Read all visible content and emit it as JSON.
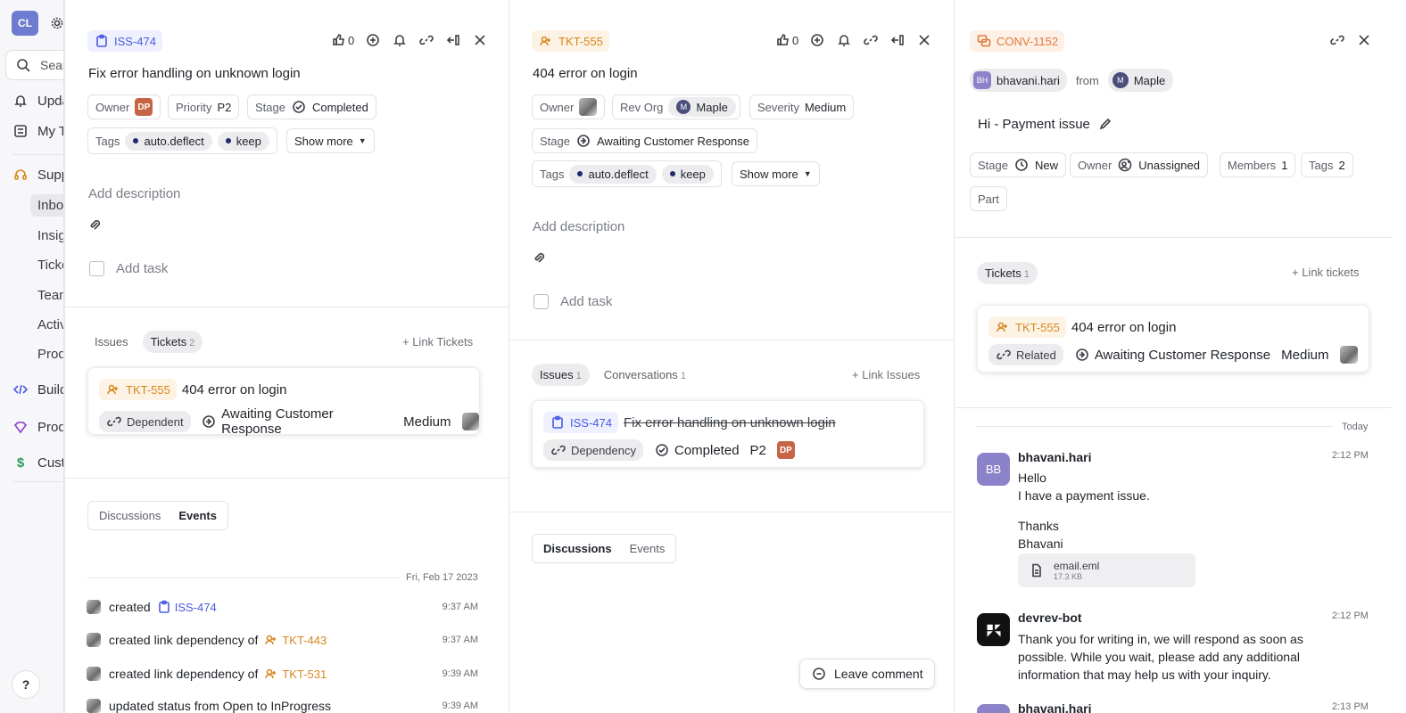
{
  "sidebar": {
    "avatar": "CL",
    "search_placeholder": "Search",
    "items": [
      {
        "label": "Updates",
        "icon": "bell-icon"
      },
      {
        "label": "My Tasks",
        "icon": "list-icon"
      }
    ],
    "support": {
      "label": "Support",
      "icon": "headset-icon"
    },
    "support_sub": [
      "Inbox",
      "Insights",
      "Tickets",
      "Team",
      "Activity",
      "Product"
    ],
    "more": [
      {
        "label": "Build",
        "icon": "code-icon"
      },
      {
        "label": "Product",
        "icon": "diamond-icon"
      },
      {
        "label": "Customers",
        "icon": "dollar-icon"
      }
    ],
    "help": "?"
  },
  "issue": {
    "id": "ISS-474",
    "upvotes": "0",
    "title": "Fix error handling on unknown login",
    "owner_label": "Owner",
    "owner_initials": "DP",
    "priority_label": "Priority",
    "priority_value": "P2",
    "stage_label": "Stage",
    "stage_value": "Completed",
    "tags_label": "Tags",
    "tags": [
      "auto.deflect",
      "keep"
    ],
    "show_more": "Show more",
    "add_description": "Add description",
    "add_task": "Add task",
    "tabs": {
      "issues": "Issues",
      "tickets": "Tickets",
      "tickets_count": "2"
    },
    "link_tickets": "+ Link Tickets",
    "linked_ticket": {
      "id": "TKT-555",
      "title": "404 error on login",
      "relation": "Dependent",
      "status": "Awaiting Customer Response",
      "severity": "Medium"
    },
    "seg": {
      "discussions": "Discussions",
      "events": "Events"
    },
    "date_sep": "Fri, Feb 17 2023",
    "events": [
      {
        "text": "created",
        "ref": "ISS-474",
        "time": "9:37 AM"
      },
      {
        "text": "created link dependency of",
        "ref": "TKT-443",
        "time": "9:37 AM"
      },
      {
        "text": "created link dependency of",
        "ref": "TKT-531",
        "time": "9:39 AM"
      },
      {
        "text": "updated status from Open to InProgress",
        "ref": "",
        "time": "9:39 AM"
      }
    ]
  },
  "ticket": {
    "id": "TKT-555",
    "upvotes": "0",
    "title": "404 error on login",
    "owner_label": "Owner",
    "revorg_label": "Rev Org",
    "revorg_value": "Maple",
    "revorg_initial": "M",
    "severity_label": "Severity",
    "severity_value": "Medium",
    "stage_label": "Stage",
    "stage_value": "Awaiting Customer Response",
    "tags_label": "Tags",
    "tags": [
      "auto.deflect",
      "keep"
    ],
    "show_more": "Show more",
    "add_description": "Add description",
    "add_task": "Add task",
    "tabs": {
      "issues": "Issues",
      "issues_count": "1",
      "conversations": "Conversations",
      "conversations_count": "1"
    },
    "link_issues": "+ Link Issues",
    "linked_issue": {
      "id": "ISS-474",
      "title": "Fix error handling on unknown login",
      "relation": "Dependency",
      "status": "Completed",
      "priority": "P2",
      "owner_initials": "DP"
    },
    "seg": {
      "discussions": "Discussions",
      "events": "Events"
    },
    "leave_comment": "Leave comment"
  },
  "conversation": {
    "id": "CONV-1152",
    "from_user": "bhavani.hari",
    "from_initials": "BH",
    "from_label": "from",
    "org": "Maple",
    "org_initial": "M",
    "title": "Hi - Payment issue",
    "stage_label": "Stage",
    "stage_value": "New",
    "owner_label": "Owner",
    "owner_value": "Unassigned",
    "members_label": "Members",
    "members_value": "1",
    "tags_label": "Tags",
    "tags_value": "2",
    "part_label": "Part",
    "tickets_tab": "Tickets",
    "tickets_count": "1",
    "link_tickets": "+ Link tickets",
    "linked_ticket": {
      "id": "TKT-555",
      "title": "404 error on login",
      "relation": "Related",
      "status": "Awaiting Customer Response",
      "severity": "Medium"
    },
    "today": "Today",
    "messages": [
      {
        "author": "bhavani.hari",
        "initials": "BB",
        "time": "2:12 PM",
        "lines": [
          "Hello",
          "I have a payment issue.",
          "",
          "Thanks",
          "Bhavani"
        ],
        "file": {
          "name": "email.eml",
          "size": "17.3 KB"
        }
      },
      {
        "author": "devrev-bot",
        "time": "2:12 PM",
        "lines": [
          "Thank you for writing in, we will respond as soon as",
          "possible. While you wait, please add any additional",
          "information that may help us with your inquiry."
        ]
      },
      {
        "author": "bhavani.hari",
        "initials": "BB",
        "time": "2:13 PM"
      }
    ]
  }
}
